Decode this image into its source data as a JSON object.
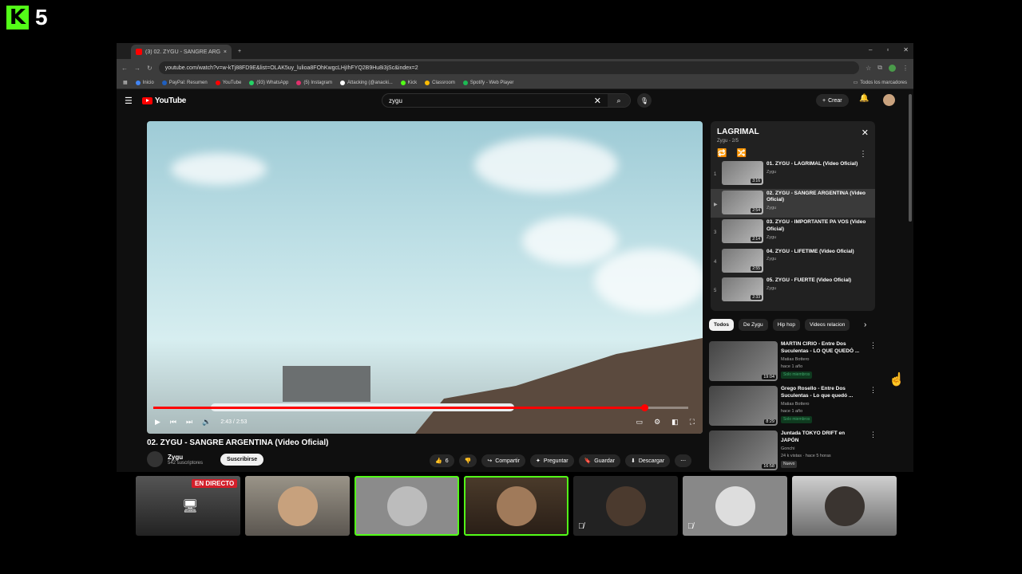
{
  "overlay": {
    "badge_number": "5"
  },
  "browser": {
    "tab_title": "(3) 02. ZYGU - SANGRE ARGENTIN",
    "url": "youtube.com/watch?v=w-kTj88FD9E&list=OLAK5uy_lulioa8FOhKwgcLHjIhFYQ2B9Hu8i3jSc&index=2",
    "bookmarks": [
      "Inicio",
      "PayPal: Resumen",
      "YouTube",
      "(93) WhatsApp",
      "(5) Instagram",
      "Attacking (@anacki...",
      "Kick",
      "Classroom",
      "Spotify - Web Player"
    ],
    "bookmarks_right": "Todos los marcadores"
  },
  "youtube": {
    "logo": "YouTube",
    "search_value": "zygu",
    "create_label": "Crear",
    "video": {
      "time": "2:43 / 2:53",
      "progress": 0.92,
      "title": "02. ZYGU - SANGRE ARGENTINA (Video Oficial)",
      "channel": "Zygu",
      "subscribers": "542 suscriptores",
      "subscribe_label": "Suscribirse",
      "likes": "6",
      "share": "Compartir",
      "ask": "Preguntar",
      "save": "Guardar",
      "download": "Descargar"
    },
    "playlist": {
      "title": "LAGRIMAL",
      "subtitle": "Zygu - 2/5",
      "items": [
        {
          "idx": "1",
          "title": "01. ZYGU - LAGRIMAL (Video Oficial)",
          "by": "Zygu",
          "dur": "3:16"
        },
        {
          "idx": "▶",
          "title": "02. ZYGU - SANGRE ARGENTINA (Video Oficial)",
          "by": "Zygu",
          "dur": "2:54"
        },
        {
          "idx": "3",
          "title": "03. ZYGU - IMPORTANTE PA VOS (Video Oficial)",
          "by": "Zygu",
          "dur": "2:14"
        },
        {
          "idx": "4",
          "title": "04. ZYGU - LIFETIME (Video Oficial)",
          "by": "Zygu",
          "dur": "2:55"
        },
        {
          "idx": "5",
          "title": "05. ZYGU - FUERTE (Video Oficial)",
          "by": "Zygu",
          "dur": "2:33"
        }
      ]
    },
    "chips": [
      "Todos",
      "De Zygu",
      "Hip hop",
      "Videos relacion"
    ],
    "recs": [
      {
        "title": "MARTIN CIRIO - Entre Dos Suculentas - LO QUE QUEDÓ ...",
        "channel": "Matias Bottero",
        "meta": "hace 1 año",
        "badge": "Solo miembros",
        "dur": "19:04"
      },
      {
        "title": "Grego Rosello - Entre Dos Suculentas - Lo que quedó ...",
        "channel": "Matias Bottero",
        "meta": "hace 1 año",
        "badge": "Solo miembros",
        "dur": "8:29"
      },
      {
        "title": "Juntada TOKYO DRIFT en JAPÓN",
        "channel": "Gonchi",
        "meta": "24 k vistas · hace 5 horas",
        "badge": "Nuevo",
        "dur": "16:58"
      }
    ]
  },
  "cams": {
    "live_label": "EN DIRECTO"
  }
}
